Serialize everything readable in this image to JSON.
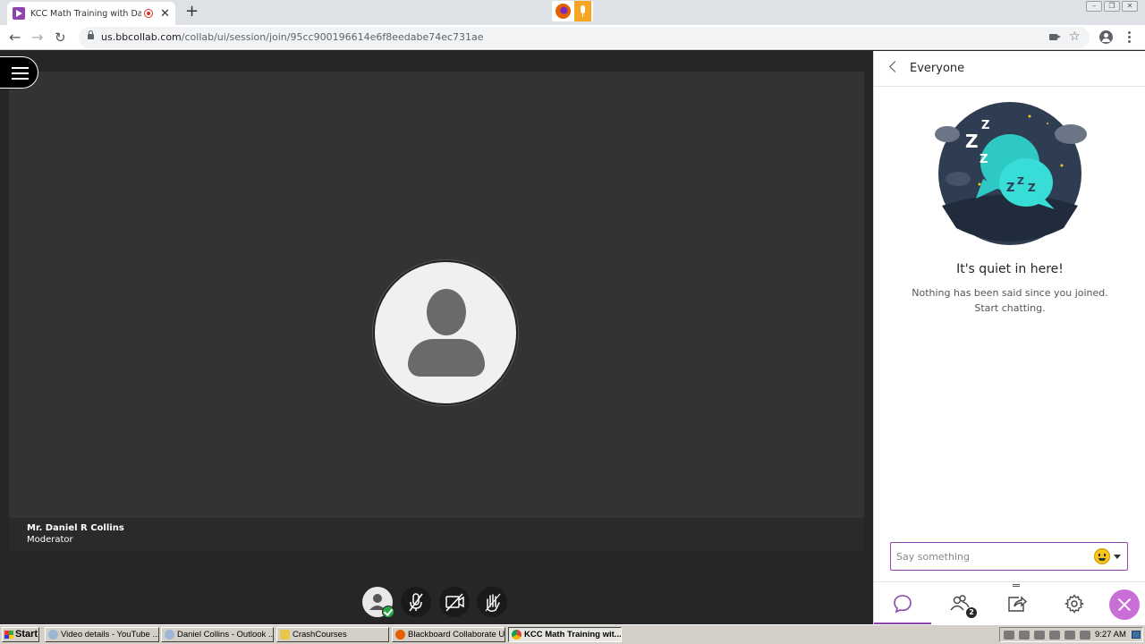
{
  "browser": {
    "tab_title": "KCC Math Training with Dan Co",
    "address_host": "us.bbcollab.com",
    "address_path": "/collab/ui/session/join/95cc900196614e6f8eedabe74ec731ae"
  },
  "session": {
    "presenter_name": "Mr. Daniel R Collins",
    "presenter_role": "Moderator"
  },
  "panel": {
    "title": "Everyone",
    "empty_title": "It's quiet in here!",
    "empty_line1": "Nothing has been said since you joined.",
    "empty_line2": "Start chatting.",
    "input_placeholder": "Say something",
    "attendee_count": "2",
    "accent_color": "#8e44ad",
    "tabs": [
      "chat-icon",
      "attendees-icon",
      "share-content-icon",
      "settings-icon",
      "close-icon"
    ]
  },
  "taskbar": {
    "start_label": "Start",
    "tasks": [
      "Video details - YouTube ...",
      "Daniel Collins - Outlook ...",
      "CrashCourses",
      "Blackboard Collaborate U...",
      "KCC Math Training wit..."
    ],
    "clock": "9:27 AM"
  }
}
